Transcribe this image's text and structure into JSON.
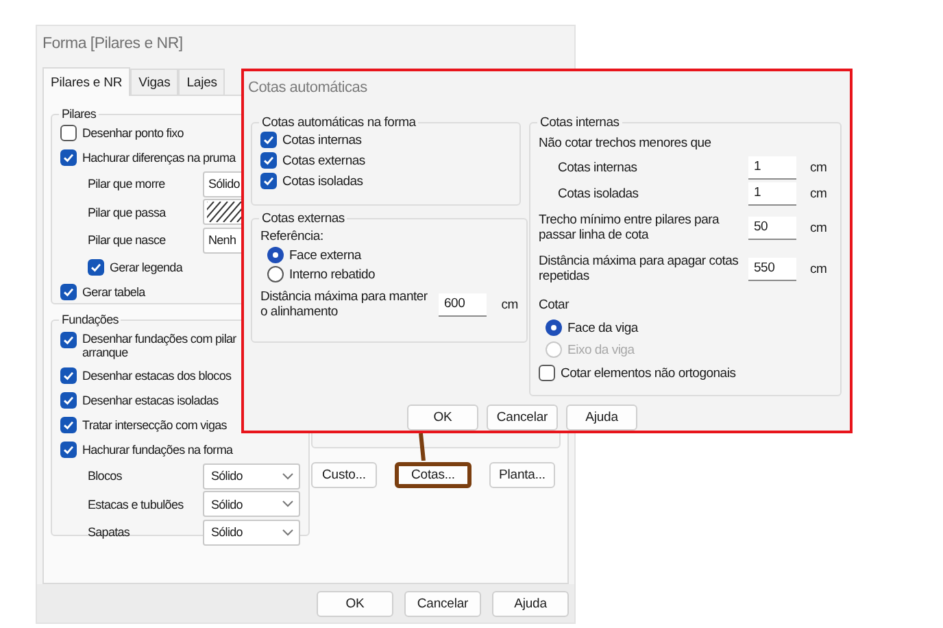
{
  "main_window": {
    "title": "Forma [Pilares e NR]",
    "tabs": [
      {
        "label": "Pilares e NR",
        "selected": true
      },
      {
        "label": "Vigas",
        "selected": false
      },
      {
        "label": "Lajes",
        "selected": false
      }
    ],
    "pilares": {
      "title": "Pilares",
      "items": [
        {
          "kind": "check",
          "label": "Desenhar ponto fixo",
          "checked": false
        },
        {
          "kind": "check",
          "label": "Hachurar diferenças na pruma",
          "checked": true
        },
        {
          "kind": "combo",
          "label": "Pilar que morre",
          "value": "Sólido"
        },
        {
          "kind": "hatch",
          "label": "Pilar que passa"
        },
        {
          "kind": "combo",
          "label": "Pilar que nasce",
          "value": "Nenh"
        },
        {
          "kind": "subcheck",
          "label": "Gerar legenda",
          "checked": true
        },
        {
          "kind": "check",
          "label": "Gerar tabela",
          "checked": true
        }
      ]
    },
    "fundacoes": {
      "title": "Fundações",
      "items": [
        {
          "kind": "check",
          "label": "Desenhar fundações com pilar arranque",
          "checked": true
        },
        {
          "kind": "check",
          "label": "Desenhar estacas dos blocos",
          "checked": true
        },
        {
          "kind": "check",
          "label": "Desenhar estacas isoladas",
          "checked": true
        },
        {
          "kind": "check",
          "label": "Tratar intersecção com vigas",
          "checked": true
        },
        {
          "kind": "check",
          "label": "Hachurar fundações na forma",
          "checked": true
        },
        {
          "kind": "combo",
          "label": "Blocos",
          "value": "Sólido"
        },
        {
          "kind": "combo",
          "label": "Estacas e tubulões",
          "value": "Sólido"
        },
        {
          "kind": "combo",
          "label": "Sapatas",
          "value": "Sólido"
        }
      ]
    },
    "side_buttons": [
      {
        "label": "Custo...",
        "highlighted": false
      },
      {
        "label": "Cotas...",
        "highlighted": true
      },
      {
        "label": "Planta...",
        "highlighted": false
      }
    ],
    "buttons": [
      "OK",
      "Cancelar",
      "Ajuda"
    ]
  },
  "dialog": {
    "title": "Cotas automáticas",
    "auto_group": {
      "title": "Cotas automáticas na forma",
      "items": [
        {
          "label": "Cotas internas",
          "checked": true
        },
        {
          "label": "Cotas externas",
          "checked": true
        },
        {
          "label": "Cotas isoladas",
          "checked": true
        }
      ]
    },
    "external_group": {
      "title": "Cotas externas",
      "reference_label": "Referência:",
      "options": [
        {
          "label": "Face externa",
          "selected": true
        },
        {
          "label": "Interno rebatido",
          "selected": false
        }
      ],
      "distance_label": "Distância máxima para manter o alinhamento",
      "distance_value": "600",
      "unit": "cm"
    },
    "internal_group": {
      "title": "Cotas internas",
      "subtitle": "Não cotar trechos menores que",
      "fields": [
        {
          "kind": "sub",
          "label": "Cotas internas",
          "value": "1",
          "unit": "cm"
        },
        {
          "kind": "sub",
          "label": "Cotas isoladas",
          "value": "1",
          "unit": "cm"
        },
        {
          "kind": "main",
          "label": "Trecho mínimo entre pilares para passar linha de cota",
          "value": "50",
          "unit": "cm"
        },
        {
          "kind": "main",
          "label": "Distância máxima para apagar cotas repetidas",
          "value": "550",
          "unit": "cm"
        }
      ],
      "cotar_label": "Cotar",
      "options": [
        {
          "label": "Face da viga",
          "selected": true,
          "disabled": false
        },
        {
          "label": "Eixo da viga",
          "selected": false,
          "disabled": true
        }
      ],
      "ortho": {
        "label": "Cotar elementos não ortogonais",
        "checked": false
      }
    },
    "buttons": [
      "OK",
      "Cancelar",
      "Ajuda"
    ]
  }
}
